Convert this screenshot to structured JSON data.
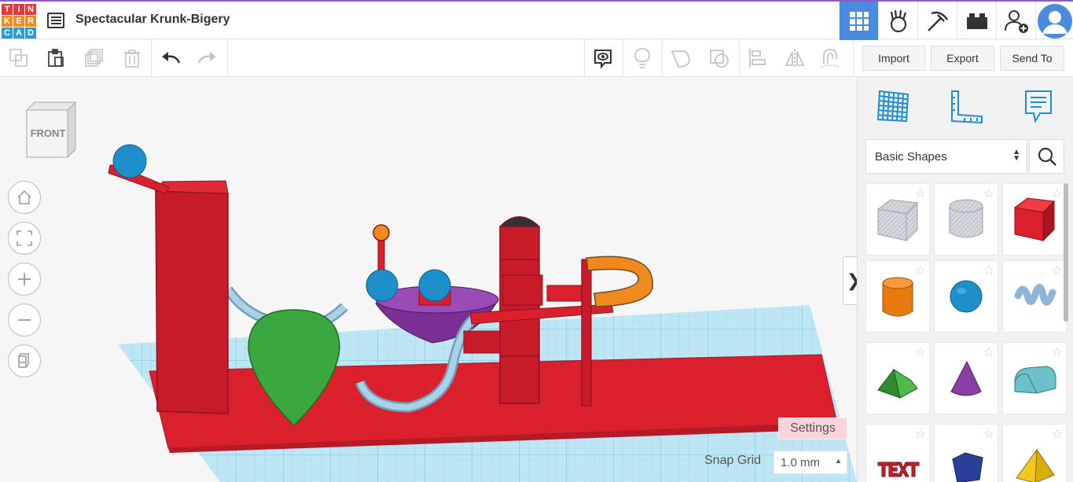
{
  "app": {
    "logo_letters": [
      "T",
      "I",
      "N",
      "K",
      "E",
      "R",
      "C",
      "A",
      "D"
    ],
    "logo_colors": [
      "#e7373b",
      "#e7373b",
      "#e7373b",
      "#f18c22",
      "#f18c22",
      "#f18c22",
      "#2b9ad8",
      "#2b9ad8",
      "#2b9ad8"
    ],
    "design_title": "Spectacular Krunk-Bigery"
  },
  "topbar": {
    "icons": [
      "grid-view-icon",
      "bricks-hand-icon",
      "pickaxe-icon",
      "brick-icon",
      "add-user-icon",
      "avatar"
    ],
    "active_color": "#4a8be0"
  },
  "toolbar": {
    "import_label": "Import",
    "export_label": "Export",
    "send_to_label": "Send To"
  },
  "workplane": {
    "viewcube_label": "FRONT",
    "settings_label": "Settings",
    "snap_grid_label": "Snap Grid",
    "snap_grid_value": "1.0 mm"
  },
  "sidebar": {
    "category": "Basic Shapes",
    "shapes": [
      {
        "name": "Box Hole",
        "color": "#c8ccd2"
      },
      {
        "name": "Cylinder Hole",
        "color": "#c8ccd2"
      },
      {
        "name": "Box",
        "color": "#e01e2a"
      },
      {
        "name": "Cylinder",
        "color": "#f08a1c"
      },
      {
        "name": "Sphere",
        "color": "#1d8fca"
      },
      {
        "name": "Scribble",
        "color": "#8fb4da"
      },
      {
        "name": "Roof",
        "color": "#3da33a"
      },
      {
        "name": "Cone",
        "color": "#8a3fa8"
      },
      {
        "name": "Round Roof",
        "color": "#6cc0c9"
      },
      {
        "name": "Text",
        "color": "#c8202a"
      },
      {
        "name": "Polygon",
        "color": "#2a3f9a"
      },
      {
        "name": "Pyramid",
        "color": "#f2c81e"
      }
    ]
  }
}
